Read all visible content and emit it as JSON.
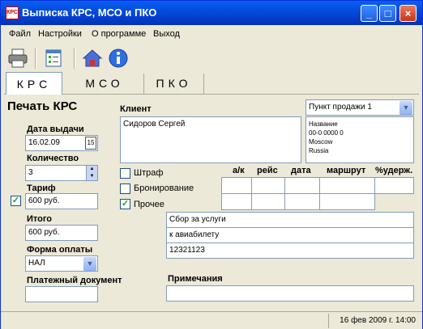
{
  "window": {
    "app_icon": "КРС",
    "title": "Выписка КРС, МСО и ПКО"
  },
  "menu": [
    "Файл",
    "Настройки",
    "О программе",
    "Выход"
  ],
  "toolbar": {
    "icons": [
      "printer-icon",
      "checklist-icon",
      "home-icon",
      "info-icon"
    ]
  },
  "tabs": [
    "КРС",
    "МСО",
    "ПКО"
  ],
  "form": {
    "heading": "Печать КРС",
    "issue_date_label": "Дата выдачи",
    "issue_date_value": "16.02.09",
    "quantity_label": "Количество",
    "quantity_value": "3",
    "tariff_label": "Тариф",
    "tariff_value": "600 руб.",
    "tariff_checked": true,
    "total_label": "Итого",
    "total_value": "600 руб.",
    "payment_label": "Форма оплаты",
    "payment_value": "НАЛ",
    "payment_doc_label": "Платежный документ",
    "payment_doc_value": "",
    "client_label": "Клиент",
    "client_value": "Сидоров Сергей",
    "sale_point_value": "Пункт продажи 1",
    "sale_point_details": [
      "Название",
      "00-0 0000 0",
      "Moscow",
      "Russia"
    ],
    "checks": [
      {
        "label": "Штраф",
        "checked": false
      },
      {
        "label": "Бронирование",
        "checked": false
      },
      {
        "label": "Прочее",
        "checked": true
      }
    ],
    "grid_headers": [
      "а/к",
      "рейс",
      "дата",
      "маршрут",
      "%удерж."
    ],
    "other_lines": [
      "Сбор за услуги",
      "к авиабилету",
      "12321123"
    ],
    "notes_label": "Примечания",
    "notes_value": ""
  },
  "status": {
    "datetime": "16 фев 2009 г. 14:00"
  },
  "colors": {
    "title_bar": "#0347d9",
    "window_bg": "#ece9d8",
    "checkbox_mark": "#21a121"
  }
}
